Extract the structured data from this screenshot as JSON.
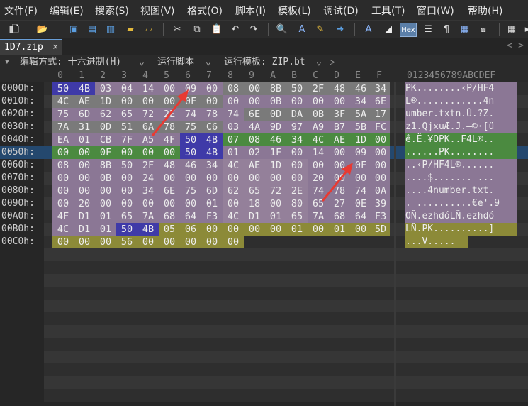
{
  "menu": [
    "文件(F)",
    "编辑(E)",
    "搜索(S)",
    "视图(V)",
    "格式(O)",
    "脚本(I)",
    "模板(L)",
    "调试(D)",
    "工具(T)",
    "窗口(W)",
    "帮助(H)"
  ],
  "toolbar": {
    "hex_label": "Hex",
    "paragraph_glyph": "¶"
  },
  "tab": {
    "filename": "1D7.zip",
    "close": "×",
    "nav_left": "<",
    "nav_right": ">"
  },
  "infobar": {
    "edit_mode": "编辑方式: 十六进制(H)",
    "run_script": "运行脚本",
    "run_template": "运行模板: ZIP.bt",
    "play": "▷"
  },
  "columns": [
    "0",
    "1",
    "2",
    "3",
    "4",
    "5",
    "6",
    "7",
    "8",
    "9",
    "A",
    "B",
    "C",
    "D",
    "E",
    "F"
  ],
  "ascii_header": "0123456789ABCDEF",
  "colors": {
    "purple": "#8b7795",
    "gray": "#7a7a7a",
    "green": "#4b8a40",
    "blue_sel": "#3f3aa8",
    "olive": "#8c8a38",
    "row_highlight": "#24486e",
    "arrow": "#e83a32"
  },
  "rows": [
    {
      "addr": "0000h:",
      "hex": [
        "50",
        "4B",
        "03",
        "04",
        "14",
        "00",
        "09",
        "00",
        "08",
        "00",
        "8B",
        "50",
        "2F",
        "48",
        "46",
        "34"
      ],
      "ascii": "PK........‹P/HF4"
    },
    {
      "addr": "0010h:",
      "hex": [
        "4C",
        "AE",
        "1D",
        "00",
        "00",
        "00",
        "0F",
        "00",
        "00",
        "00",
        "0B",
        "00",
        "00",
        "00",
        "34",
        "6E"
      ],
      "ascii": "L®............4n"
    },
    {
      "addr": "0020h:",
      "hex": [
        "75",
        "6D",
        "62",
        "65",
        "72",
        "2E",
        "74",
        "78",
        "74",
        "6E",
        "0D",
        "DA",
        "0B",
        "3F",
        "5A",
        "17"
      ],
      "ascii": "umber.txtn.Ú.?Z."
    },
    {
      "addr": "0030h:",
      "hex": [
        "7A",
        "31",
        "0D",
        "51",
        "6A",
        "78",
        "75",
        "C6",
        "03",
        "4A",
        "9D",
        "97",
        "A9",
        "B7",
        "5B",
        "FC"
      ],
      "ascii": "z1.QjxuÆ.J.—©·[ü"
    },
    {
      "addr": "0040h:",
      "hex": [
        "EA",
        "01",
        "CB",
        "7F",
        "A5",
        "4F",
        "50",
        "4B",
        "07",
        "08",
        "46",
        "34",
        "4C",
        "AE",
        "1D",
        "00"
      ],
      "ascii": "ê.Ë.¥OPK..F4L®.."
    },
    {
      "addr": "0050h:",
      "hex": [
        "00",
        "00",
        "0F",
        "00",
        "00",
        "00",
        "50",
        "4B",
        "01",
        "02",
        "1F",
        "00",
        "14",
        "00",
        "09",
        "00"
      ],
      "ascii": "......PK........"
    },
    {
      "addr": "0060h:",
      "hex": [
        "08",
        "00",
        "8B",
        "50",
        "2F",
        "48",
        "46",
        "34",
        "4C",
        "AE",
        "1D",
        "00",
        "00",
        "00",
        "0F",
        "00"
      ],
      "ascii": "..‹P/HF4L®......"
    },
    {
      "addr": "0070h:",
      "hex": [
        "00",
        "00",
        "0B",
        "00",
        "24",
        "00",
        "00",
        "00",
        "00",
        "00",
        "00",
        "00",
        "20",
        "00",
        "00",
        "00"
      ],
      "ascii": "....$....... ..."
    },
    {
      "addr": "0080h:",
      "hex": [
        "00",
        "00",
        "00",
        "00",
        "34",
        "6E",
        "75",
        "6D",
        "62",
        "65",
        "72",
        "2E",
        "74",
        "78",
        "74",
        "0A"
      ],
      "ascii": "....4number.txt."
    },
    {
      "addr": "0090h:",
      "hex": [
        "00",
        "20",
        "00",
        "00",
        "00",
        "00",
        "00",
        "01",
        "00",
        "18",
        "00",
        "80",
        "65",
        "27",
        "0E",
        "39"
      ],
      "ascii": ". ..........€e'.9"
    },
    {
      "addr": "00A0h:",
      "hex": [
        "4F",
        "D1",
        "01",
        "65",
        "7A",
        "68",
        "64",
        "F3",
        "4C",
        "D1",
        "01",
        "65",
        "7A",
        "68",
        "64",
        "F3"
      ],
      "ascii": "OÑ.ezhdóLÑ.ezhdó"
    },
    {
      "addr": "00B0h:",
      "hex": [
        "4C",
        "D1",
        "01",
        "50",
        "4B",
        "05",
        "06",
        "00",
        "00",
        "00",
        "00",
        "01",
        "00",
        "01",
        "00",
        "5D"
      ],
      "ascii": "LÑ.PK..........]"
    },
    {
      "addr": "00C0h:",
      "hex": [
        "00",
        "00",
        "00",
        "56",
        "00",
        "00",
        "00",
        "00",
        "00"
      ],
      "ascii": "...V....."
    }
  ]
}
